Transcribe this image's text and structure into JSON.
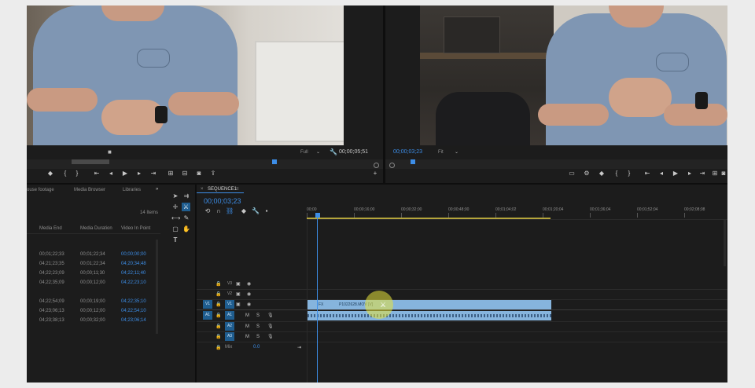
{
  "source_monitor": {
    "fit": "Full",
    "timecode": "00;00;05;51"
  },
  "program_monitor": {
    "timecode": "00;00;03;23",
    "fit": "Fit"
  },
  "project_panel": {
    "tabs": [
      "ouse footage",
      "Media Browser",
      "Libraries"
    ],
    "items_count": "14 Items",
    "columns": [
      "Media End",
      "Media Duration",
      "Video In Point"
    ],
    "rows": [
      [
        "00;01;22;33",
        "00;01;22;34",
        "00;00;00;00"
      ],
      [
        "04;21;23;35",
        "00;01;22;34",
        "04;20;34;48"
      ],
      [
        "04;22;23;09",
        "00;00;11;30",
        "04;22;11;40"
      ],
      [
        "04;22;35;09",
        "00;00;12;00",
        "04;22;23;10"
      ],
      [
        "04;22;54;09",
        "00;00;19;00",
        "04;22;35;10"
      ],
      [
        "04;23;06;13",
        "00;00;12;00",
        "04;22;54;10"
      ],
      [
        "04;23;38;13",
        "00;00;32;00",
        "04;23;06;14"
      ]
    ]
  },
  "timeline": {
    "sequence_tab": "SEQUENCE1",
    "timecode": "00;00;03;23",
    "ruler": [
      "00;00",
      "00;00;16;00",
      "00;00;32;00",
      "00;00;48;00",
      "00;01;04;02",
      "00;01;20;04",
      "00;01;36;04",
      "00;01;52;04",
      "00;02;08;08",
      "00;02;24;04"
    ],
    "tracks_video": [
      "V3",
      "V2",
      "V1"
    ],
    "tracks_audio": [
      "A1",
      "A2",
      "A3"
    ],
    "mix_label": "Mix",
    "mix_value": "0.0",
    "clip_fx": "FX",
    "clip_name": "P1022628.MOV [V]"
  }
}
